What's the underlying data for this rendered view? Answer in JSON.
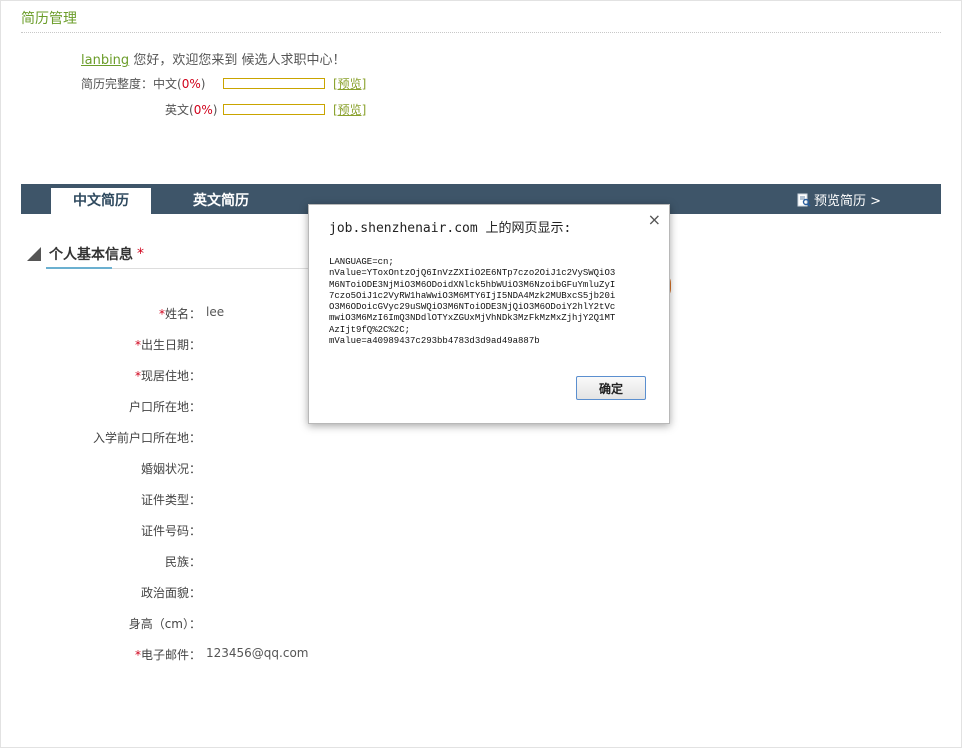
{
  "page": {
    "title": "简历管理"
  },
  "welcome": {
    "username": "lanbing",
    "message": "您好，欢迎您来到 候选人求职中心！"
  },
  "completeness": {
    "label": "简历完整度：",
    "rows": [
      {
        "lang": "中文",
        "pct_text": "0%",
        "progress": 0,
        "preview": "[预览]"
      },
      {
        "lang": "英文",
        "pct_text": "0%",
        "progress": 0,
        "preview": "[预览]"
      }
    ]
  },
  "tabs": {
    "chinese": "中文简历",
    "english": "英文简历",
    "preview_resume": "预览简历 >"
  },
  "section": {
    "title": "个人基本信息",
    "required_mark": "*"
  },
  "fields": [
    {
      "label": "姓名：",
      "required": true,
      "value": "lee"
    },
    {
      "label": "出生日期：",
      "required": true,
      "value": ""
    },
    {
      "label": "现居住地：",
      "required": true,
      "value": ""
    },
    {
      "label": "户口所在地：",
      "required": false,
      "value": ""
    },
    {
      "label": "入学前户口所在地：",
      "required": false,
      "value": ""
    },
    {
      "label": "婚姻状况：",
      "required": false,
      "value": ""
    },
    {
      "label": "证件类型：",
      "required": false,
      "value": ""
    },
    {
      "label": "证件号码：",
      "required": false,
      "value": ""
    },
    {
      "label": "民族：",
      "required": false,
      "value": ""
    },
    {
      "label": "政治面貌：",
      "required": false,
      "value": ""
    },
    {
      "label": "身高（cm）：",
      "required": false,
      "value": ""
    },
    {
      "label": "电子邮件：",
      "required": true,
      "value": "123456@qq.com"
    }
  ],
  "dialog": {
    "title": "job.shenzhenair.com 上的网页显示:",
    "close": "×",
    "body": "LANGUAGE=cn;\nnValue=YToxOntzOjQ6InVzZXIiO2E6NTp7czo2OiJ1c2VySWQiO3\nM6NToiODE3NjMiO3M6ODoidXNlck5hbWUiO3M6NzoibGFuYmluZyI\n7czo5OiJ1c2VyRW1haWwiO3M6MTY6IjI5NDA4Mzk2MUBxcS5jb20i\nO3M6ODoicGVyc29uSWQiO3M6NToiODE3NjQiO3M6ODoiY2hlY2tVc\nmwiO3M6MzI6ImQ3NDdlOTYxZGUxMjVhNDk3MzFkMzMxZjhjY2Q1MT\nAzIjt9fQ%2C%2C;\nmValue=a40989437c293bb4783d3d9ad49a887b",
    "ok": "确定"
  },
  "colors": {
    "accent_green": "#6b9d2a",
    "tabbar": "#3e5569",
    "required_red": "#d0021b",
    "progress_border": "#c9a400"
  }
}
